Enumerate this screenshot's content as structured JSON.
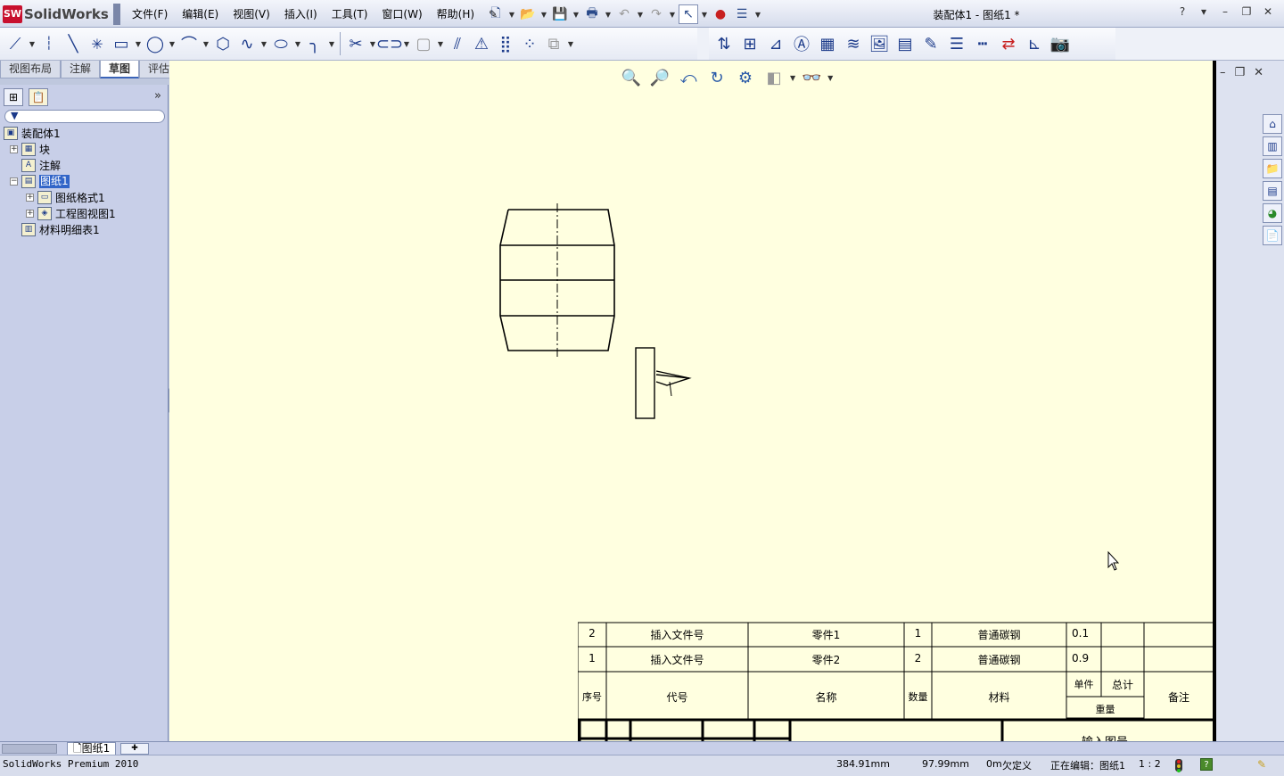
{
  "app": {
    "logo_text": "SolidWorks",
    "logo_badge": "SW",
    "document_title": "装配体1 - 图纸1 *"
  },
  "menus": [
    "文件(F)",
    "编辑(E)",
    "视图(V)",
    "插入(I)",
    "工具(T)",
    "窗口(W)",
    "帮助(H)"
  ],
  "window_controls": [
    "?",
    "▾",
    "–",
    "❐",
    "✕"
  ],
  "command_tabs": [
    "视图布局",
    "注解",
    "草图",
    "评估"
  ],
  "active_tab": "草图",
  "feature_tree": {
    "items": [
      {
        "label": "装配体1",
        "icon": "drawing-icon",
        "expander": "",
        "selected": false
      },
      {
        "label": "块",
        "icon": "block-icon",
        "expander": "+",
        "selected": false
      },
      {
        "label": "注解",
        "icon": "annotation-icon",
        "expander": "",
        "selected": false
      },
      {
        "label": "图纸1",
        "icon": "sheet-icon",
        "expander": "−",
        "selected": true
      },
      {
        "label": "图纸格式1",
        "icon": "sheet-format-icon",
        "expander": "+",
        "selected": false
      },
      {
        "label": "工程图视图1",
        "icon": "drawing-view-icon",
        "expander": "+",
        "selected": false
      },
      {
        "label": "材料明细表1",
        "icon": "bom-icon",
        "expander": "",
        "selected": false
      }
    ]
  },
  "sheet_tabs": {
    "active": "图纸1"
  },
  "bom": {
    "rows": [
      {
        "seq": "2",
        "code": "插入文件号",
        "name": "零件1",
        "qty": "1",
        "material": "普通碳钢",
        "unit_weight": "0.1",
        "total_weight": "",
        "note": ""
      },
      {
        "seq": "1",
        "code": "插入文件号",
        "name": "零件2",
        "qty": "2",
        "material": "普通碳钢",
        "unit_weight": "0.9",
        "total_weight": "",
        "note": ""
      }
    ],
    "header": {
      "seq": "序号",
      "code": "代号",
      "name": "名称",
      "qty": "数量",
      "material": "材料",
      "unit": "单件",
      "total": "总计",
      "weight": "重量",
      "note": "备注"
    },
    "partial_text": "输入图号"
  },
  "statusbar": {
    "product": "SolidWorks Premium 2010",
    "x": "384.91mm",
    "y": "97.99mm",
    "z": "0m",
    "constraint": "欠定义",
    "editing": "正在编辑：图纸1",
    "scale": "1 : 2",
    "help_glyph": "?"
  },
  "colors": {
    "sheet_background": "#ffffe0",
    "selection": "#3265c8",
    "panel": "#c8cfe8"
  }
}
